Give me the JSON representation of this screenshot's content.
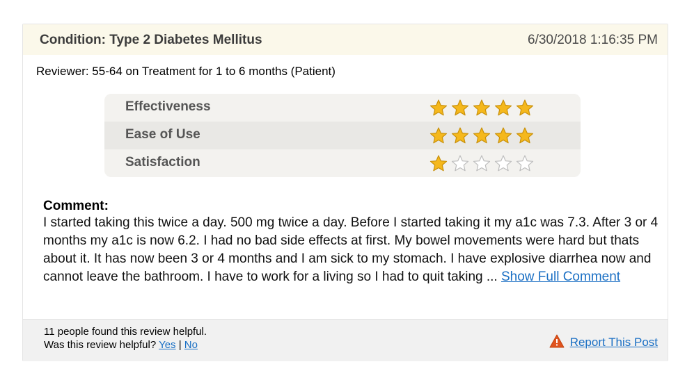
{
  "review": {
    "condition": "Condition: Type 2 Diabetes Mellitus",
    "date": "6/30/2018 1:16:35 PM",
    "reviewer": "Reviewer: 55-64 on Treatment for 1 to 6 months (Patient)",
    "ratings": [
      {
        "label": "Effectiveness",
        "stars": 5,
        "max": 5
      },
      {
        "label": "Ease of Use",
        "stars": 5,
        "max": 5
      },
      {
        "label": "Satisfaction",
        "stars": 1,
        "max": 5
      }
    ],
    "comment_title": "Comment:",
    "comment_text": "I started taking this twice a day. 500 mg twice a day. Before I started taking it my a1c was 7.3. After 3 or 4 months my a1c is now 6.2. I had no bad side effects at first. My bowel movements were hard but thats about it. It has now been 3 or 4 months and I am sick to my stomach. I have explosive diarrhea now and cannot leave the bathroom. I have to work for a living so I had to quit taking ... ",
    "show_full_label": "Show Full Comment"
  },
  "footer": {
    "helpful_count": "11 people found this review helpful.",
    "question": "Was this review helpful? ",
    "yes": "Yes",
    "separator": " | ",
    "no": "No",
    "report": "Report This Post"
  },
  "colors": {
    "star_filled": "#f5b81c",
    "star_empty": "#ffffff",
    "link": "#1a6fc4",
    "warning": "#e0531e"
  },
  "icons": [
    "star-icon",
    "warning-icon"
  ]
}
